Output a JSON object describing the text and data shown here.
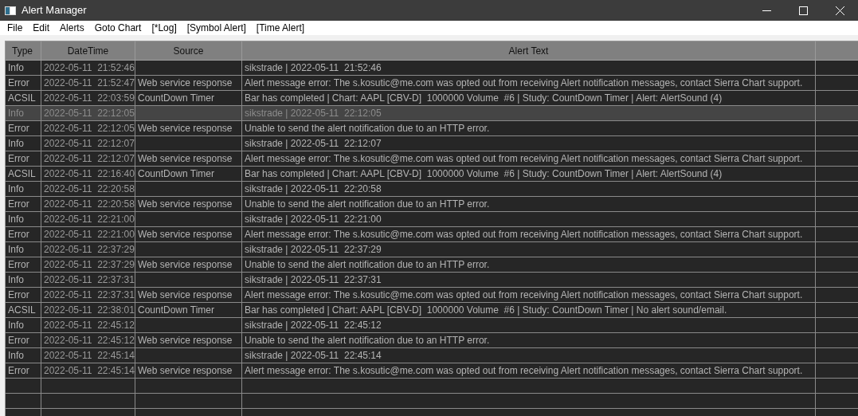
{
  "window": {
    "title": "Alert Manager"
  },
  "menu": [
    "File",
    "Edit",
    "Alerts",
    "Goto Chart",
    "[*Log]",
    "[Symbol Alert]",
    "[Time Alert]"
  ],
  "table": {
    "columns": [
      "Type",
      "DateTime",
      "Source",
      "Alert Text"
    ],
    "rows": [
      {
        "type": "Info",
        "datetime": "2022-05-11  21:52:46",
        "source": "",
        "text": "sikstrade | 2022-05-11  21:52:46",
        "selected": false
      },
      {
        "type": "Error",
        "datetime": "2022-05-11  21:52:47",
        "source": "Web service response",
        "text": "Alert message error: The s.kosutic@me.com was opted out from receiving Alert notification messages, contact Sierra Chart support.",
        "selected": false
      },
      {
        "type": "ACSIL",
        "datetime": "2022-05-11  22:03:59",
        "source": "CountDown Timer",
        "text": "Bar has completed | Chart: AAPL [CBV-D]  1000000 Volume  #6 | Study: CountDown Timer | Alert: AlertSound (4)",
        "selected": false
      },
      {
        "type": "Info",
        "datetime": "2022-05-11  22:12:05",
        "source": "",
        "text": "sikstrade | 2022-05-11  22:12:05",
        "selected": true
      },
      {
        "type": "Error",
        "datetime": "2022-05-11  22:12:05",
        "source": "Web service response",
        "text": "Unable to send the alert notification due to an HTTP error.",
        "selected": false
      },
      {
        "type": "Info",
        "datetime": "2022-05-11  22:12:07",
        "source": "",
        "text": "sikstrade | 2022-05-11  22:12:07",
        "selected": false
      },
      {
        "type": "Error",
        "datetime": "2022-05-11  22:12:07",
        "source": "Web service response",
        "text": "Alert message error: The s.kosutic@me.com was opted out from receiving Alert notification messages, contact Sierra Chart support.",
        "selected": false
      },
      {
        "type": "ACSIL",
        "datetime": "2022-05-11  22:16:40",
        "source": "CountDown Timer",
        "text": "Bar has completed | Chart: AAPL [CBV-D]  1000000 Volume  #6 | Study: CountDown Timer | Alert: AlertSound (4)",
        "selected": false
      },
      {
        "type": "Info",
        "datetime": "2022-05-11  22:20:58",
        "source": "",
        "text": "sikstrade | 2022-05-11  22:20:58",
        "selected": false
      },
      {
        "type": "Error",
        "datetime": "2022-05-11  22:20:58",
        "source": "Web service response",
        "text": "Unable to send the alert notification due to an HTTP error.",
        "selected": false
      },
      {
        "type": "Info",
        "datetime": "2022-05-11  22:21:00",
        "source": "",
        "text": "sikstrade | 2022-05-11  22:21:00",
        "selected": false
      },
      {
        "type": "Error",
        "datetime": "2022-05-11  22:21:00",
        "source": "Web service response",
        "text": "Alert message error: The s.kosutic@me.com was opted out from receiving Alert notification messages, contact Sierra Chart support.",
        "selected": false
      },
      {
        "type": "Info",
        "datetime": "2022-05-11  22:37:29",
        "source": "",
        "text": "sikstrade | 2022-05-11  22:37:29",
        "selected": false
      },
      {
        "type": "Error",
        "datetime": "2022-05-11  22:37:29",
        "source": "Web service response",
        "text": "Unable to send the alert notification due to an HTTP error.",
        "selected": false
      },
      {
        "type": "Info",
        "datetime": "2022-05-11  22:37:31",
        "source": "",
        "text": "sikstrade | 2022-05-11  22:37:31",
        "selected": false
      },
      {
        "type": "Error",
        "datetime": "2022-05-11  22:37:31",
        "source": "Web service response",
        "text": "Alert message error: The s.kosutic@me.com was opted out from receiving Alert notification messages, contact Sierra Chart support.",
        "selected": false
      },
      {
        "type": "ACSIL",
        "datetime": "2022-05-11  22:38:01",
        "source": "CountDown Timer",
        "text": "Bar has completed | Chart: AAPL [CBV-D]  1000000 Volume  #6 | Study: CountDown Timer | No alert sound/email.",
        "selected": false
      },
      {
        "type": "Info",
        "datetime": "2022-05-11  22:45:12",
        "source": "",
        "text": "sikstrade | 2022-05-11  22:45:12",
        "selected": false
      },
      {
        "type": "Error",
        "datetime": "2022-05-11  22:45:12",
        "source": "Web service response",
        "text": "Unable to send the alert notification due to an HTTP error.",
        "selected": false
      },
      {
        "type": "Info",
        "datetime": "2022-05-11  22:45:14",
        "source": "",
        "text": "sikstrade | 2022-05-11  22:45:14",
        "selected": false
      },
      {
        "type": "Error",
        "datetime": "2022-05-11  22:45:14",
        "source": "Web service response",
        "text": "Alert message error: The s.kosutic@me.com was opted out from receiving Alert notification messages, contact Sierra Chart support.",
        "selected": false
      }
    ]
  }
}
